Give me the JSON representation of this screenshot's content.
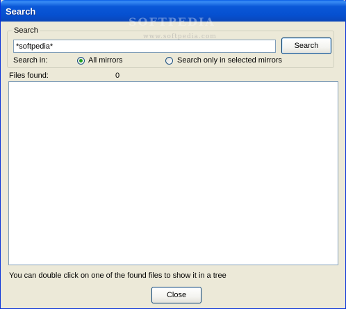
{
  "window": {
    "title": "Search",
    "watermark": "SOFTPEDIA",
    "watermark_sub": "www.softpedia.com"
  },
  "search_group": {
    "label": "Search",
    "input_value": "*softpedia*",
    "search_button": "Search",
    "search_in_label": "Search in:",
    "options": [
      {
        "label": "All mirrors",
        "selected": true
      },
      {
        "label": "Search only in selected mirrors",
        "selected": false
      }
    ]
  },
  "results": {
    "files_found_label": "Files found:",
    "files_found_count": "0",
    "items": []
  },
  "hint": "You can double click on one of the found files to show it in a tree",
  "footer": {
    "close_button": "Close"
  }
}
